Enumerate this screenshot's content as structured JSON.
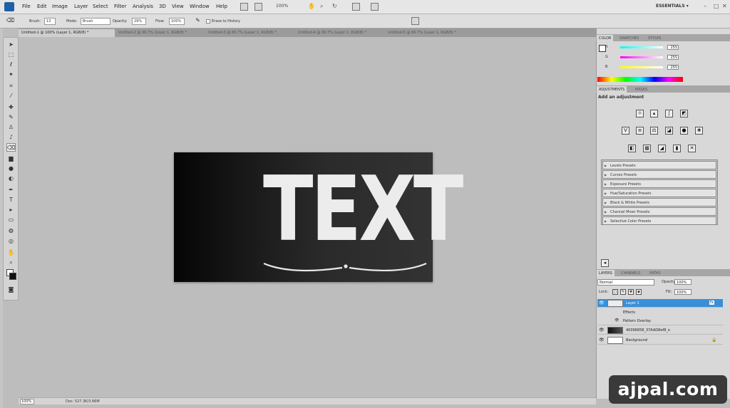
{
  "menubar": {
    "items": [
      "File",
      "Edit",
      "Image",
      "Layer",
      "Select",
      "Filter",
      "Analysis",
      "3D",
      "View",
      "Window",
      "Help"
    ],
    "zoom": "100%",
    "workspace": "ESSENTIALS ▾"
  },
  "options": {
    "brush_label": "Brush:",
    "brush_size": "13",
    "mode_label": "Mode:",
    "mode_value": "Brush",
    "opacity_label": "Opacity:",
    "opacity_value": "29%",
    "flow_label": "Flow:",
    "flow_value": "100%",
    "erase_history": "Erase to History"
  },
  "tabs": [
    "Untitled-1 @ 100% (Layer 1, RGB/8) *",
    "Untitled-2 @ 66.7% (Layer 1, RGB/8) *",
    "Untitled-3 @ 66.7% (Layer 1, RGB/8) *",
    "Untitled-4 @ 66.7% (Layer 1, RGB/8) *",
    "Untitled-5 @ 66.7% (Layer 1, RGB/8) *"
  ],
  "canvas": {
    "text": "TEXT"
  },
  "status": {
    "zoom": "100%",
    "doc": "Doc: 527.3K/3.66M"
  },
  "color_panel": {
    "tabs": [
      "COLOR",
      "SWATCHES",
      "STYLES"
    ],
    "sliders": [
      {
        "label": "R",
        "value": "255"
      },
      {
        "label": "G",
        "value": "255"
      },
      {
        "label": "B",
        "value": "255"
      }
    ]
  },
  "adjustments": {
    "tabs": [
      "ADJUSTMENTS",
      "MASKS"
    ],
    "heading": "Add an adjustment",
    "presets": [
      "Levels Presets",
      "Curves Presets",
      "Exposure Presets",
      "Hue/Saturation Presets",
      "Black & White Presets",
      "Channel Mixer Presets",
      "Selective Color Presets"
    ]
  },
  "layers": {
    "tabs": [
      "LAYERS",
      "CHANNELS",
      "PATHS"
    ],
    "blend_mode": "Normal",
    "opacity_label": "Opacity:",
    "opacity_value": "100%",
    "lock_label": "Lock:",
    "fill_label": "Fill:",
    "fill_value": "100%",
    "rows": [
      {
        "name": "Layer 1"
      },
      {
        "name": "Effects"
      },
      {
        "name": "Pattern Overlay"
      },
      {
        "name": "40096858_37AAD8ef8_o"
      },
      {
        "name": "Background"
      }
    ]
  },
  "watermark": "ajpal.com"
}
